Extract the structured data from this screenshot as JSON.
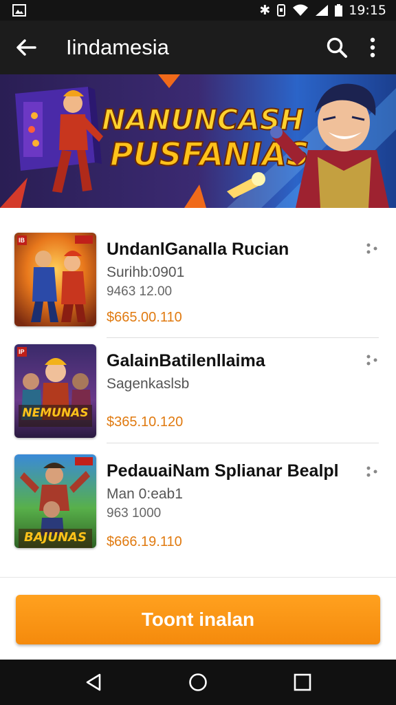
{
  "status_bar": {
    "time": "19:15"
  },
  "app_bar": {
    "title": "Iindamesia"
  },
  "banner": {
    "line1": "NANUNCASH",
    "line2": "PUSFANIAS"
  },
  "items": [
    {
      "title": "UndanlGanalla Rucian",
      "sub": "Surihb:0901",
      "meta": "9463 12.00",
      "price": "$665.00.110",
      "badge": "IB",
      "box_text": ""
    },
    {
      "title": "GalainBatilenllaima",
      "sub": "Sagenkaslsb",
      "meta": "",
      "price": "$365.10.120",
      "badge": "IP",
      "box_text": "NEMUNAS"
    },
    {
      "title": "PedauaiNam Splianar Bealpl",
      "sub": "Man 0:eab1",
      "meta": "963 1000",
      "price": "$666.19.110",
      "badge": "",
      "box_text": "BAJUNAS"
    }
  ],
  "bottom": {
    "button_label": "Toont inalan"
  },
  "colors": {
    "accent": "#f58a0c",
    "price": "#e07a10",
    "app_bar": "#1c1c1c"
  },
  "icons": [
    "image-icon",
    "bluetooth-icon",
    "vibrate-icon",
    "wifi-icon",
    "signal-icon",
    "battery-icon",
    "back-arrow-icon",
    "search-icon",
    "more-vert-icon",
    "overflow-menu-icon",
    "nav-back-icon",
    "nav-home-icon",
    "nav-recents-icon"
  ]
}
